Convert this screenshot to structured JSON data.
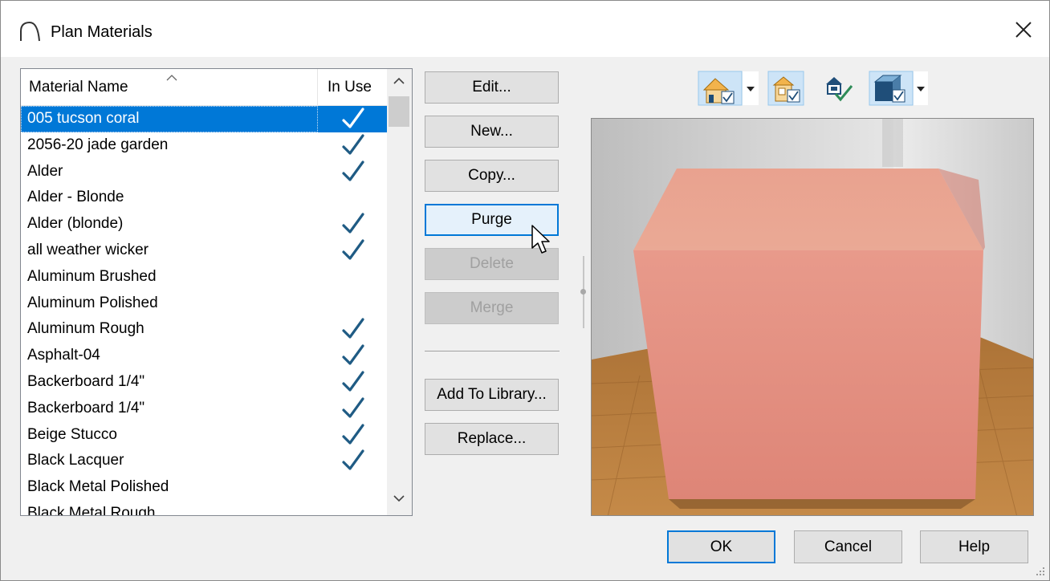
{
  "window": {
    "title": "Plan Materials",
    "close_icon": "close-icon",
    "app_icon": "arc-icon"
  },
  "list": {
    "headers": {
      "name": "Material Name",
      "in_use": "In Use"
    },
    "sort_indicator": "sort-ascending-caret",
    "selected_index": 0,
    "items": [
      {
        "name": "005 tucson coral",
        "in_use": true
      },
      {
        "name": "2056-20 jade garden",
        "in_use": true
      },
      {
        "name": "Alder",
        "in_use": true
      },
      {
        "name": "Alder - Blonde",
        "in_use": false
      },
      {
        "name": "Alder (blonde)",
        "in_use": true
      },
      {
        "name": "all weather wicker",
        "in_use": true
      },
      {
        "name": "Aluminum Brushed",
        "in_use": false
      },
      {
        "name": "Aluminum Polished",
        "in_use": false
      },
      {
        "name": "Aluminum Rough",
        "in_use": true
      },
      {
        "name": "Asphalt-04",
        "in_use": true
      },
      {
        "name": "Backerboard 1/4\"",
        "in_use": true
      },
      {
        "name": "Backerboard 1/4\"",
        "in_use": true
      },
      {
        "name": "Beige Stucco",
        "in_use": true
      },
      {
        "name": "Black Lacquer",
        "in_use": true
      },
      {
        "name": "Black Metal Polished",
        "in_use": false
      },
      {
        "name": "Black Metal Rough",
        "in_use": false
      }
    ]
  },
  "actions": {
    "edit": "Edit...",
    "new": "New...",
    "copy": "Copy...",
    "purge": "Purge",
    "delete": "Delete",
    "merge": "Merge",
    "add_to_library": "Add To Library...",
    "replace": "Replace..."
  },
  "toolbar": {
    "icons": [
      "house-view-dropdown-icon",
      "room-view-icon",
      "in-use-check-icon",
      "box-view-dropdown-icon"
    ]
  },
  "footer": {
    "ok": "OK",
    "cancel": "Cancel",
    "help": "Help"
  },
  "colors": {
    "selection": "#0078d7",
    "check": "#1f5b84",
    "preview_cube": "#e59587",
    "floor": "#b57a3c"
  }
}
